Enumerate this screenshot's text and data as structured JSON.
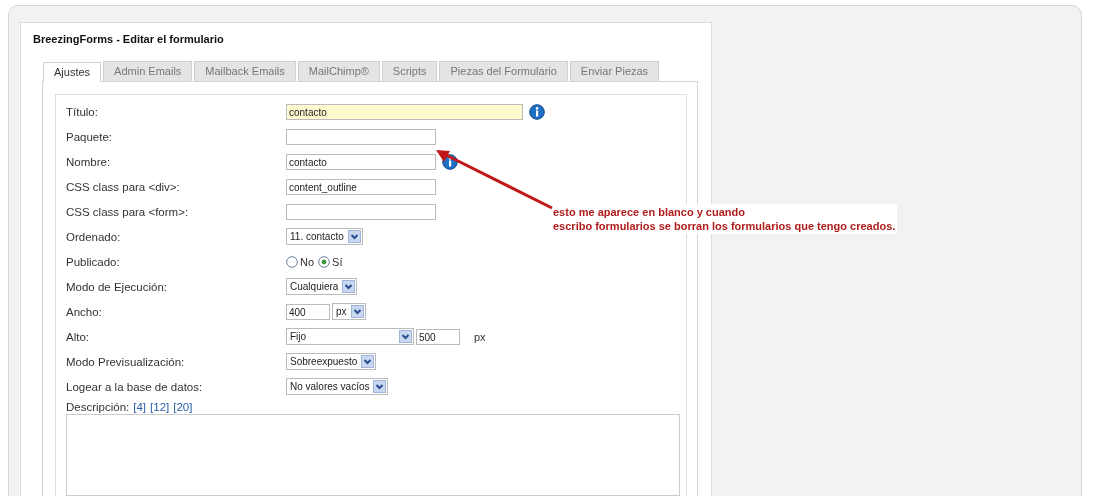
{
  "panel": {
    "title": "BreezingForms - Editar el formulario"
  },
  "tabs": [
    {
      "label": "Ajustes",
      "selected": true
    },
    {
      "label": "Admin Emails",
      "selected": false
    },
    {
      "label": "Mailback Emails",
      "selected": false
    },
    {
      "label": "MailChimp®",
      "selected": false
    },
    {
      "label": "Scripts",
      "selected": false
    },
    {
      "label": "Piezas del Formulario",
      "selected": false
    },
    {
      "label": "Enviar Piezas",
      "selected": false
    }
  ],
  "rows": [
    {
      "label": "Título:",
      "info": true,
      "controls": [
        {
          "kind": "text-wide",
          "value": "contacto",
          "highlighted": true
        }
      ]
    },
    {
      "label": "Paquete:",
      "info": false,
      "controls": [
        {
          "kind": "text",
          "highlighted": false
        }
      ]
    },
    {
      "label": "Nombre:",
      "info": true,
      "controls": [
        {
          "kind": "text",
          "value": "contacto",
          "highlighted": false
        }
      ]
    },
    {
      "label": "CSS class para <div>:",
      "info": false,
      "controls": [
        {
          "kind": "text",
          "value": "content_outline",
          "highlighted": false
        }
      ]
    },
    {
      "label": "CSS class para <form>:",
      "info": false,
      "controls": [
        {
          "kind": "text",
          "highlighted": false
        }
      ]
    },
    {
      "label": "Ordenado:",
      "info": false,
      "controls": [
        {
          "kind": "select",
          "value": "11. contacto"
        }
      ]
    },
    {
      "label": "Publicado:",
      "info": false,
      "controls": [
        {
          "kind": "radio",
          "label": "No",
          "selected": false
        },
        {
          "kind": "radio",
          "label": "Sí",
          "selected": true
        }
      ]
    },
    {
      "label": "Modo de Ejecución:",
      "info": false,
      "controls": [
        {
          "kind": "select",
          "value": "Cualquiera"
        }
      ]
    },
    {
      "label": "Ancho:",
      "info": false,
      "controls": [
        {
          "kind": "text-short",
          "value": "400",
          "highlighted": false
        },
        {
          "kind": "select",
          "value": "px"
        }
      ]
    },
    {
      "label": "Alto:",
      "info": false,
      "controls": [
        {
          "kind": "select-wide",
          "value": "Fijo"
        },
        {
          "kind": "text-short",
          "value": "500",
          "highlighted": false
        },
        {
          "kind": "unit",
          "value": "px"
        }
      ]
    },
    {
      "label": "Modo Previsualización:",
      "info": false,
      "controls": [
        {
          "kind": "select",
          "value": "Sobreexpuesto"
        }
      ]
    },
    {
      "label": "Logear a la base de datos:",
      "info": false,
      "controls": [
        {
          "kind": "select",
          "value": "No valores vacíos"
        }
      ]
    }
  ],
  "description": {
    "label": "Descripción:",
    "links": [
      "[4]",
      "[12]",
      "[20]"
    ]
  },
  "annotation": {
    "lines": [
      "esto me aparece en blanco y cuando",
      "escribo formularios se borran los formularios que tengo creados."
    ]
  }
}
